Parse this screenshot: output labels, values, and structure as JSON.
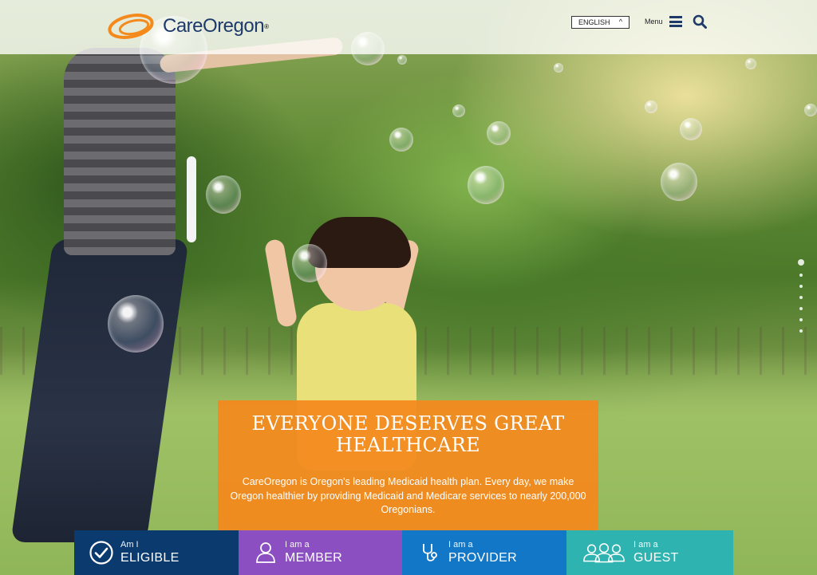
{
  "header": {
    "brand": "CareOregon",
    "language": "ENGLISH",
    "menu_label": "Menu"
  },
  "hero": {
    "headline": "EVERYONE DESERVES GREAT HEALTHCARE",
    "body": "CareOregon is Oregon's leading Medicaid health plan. Every day, we make Oregon healthier by providing Medicaid and Medicare services to nearly 200,000 Oregonians."
  },
  "tiles": [
    {
      "small": "Am I",
      "big": "ELIGIBLE",
      "icon": "check-circle-icon",
      "color": "#0b3a6e"
    },
    {
      "small": "I am a",
      "big": "MEMBER",
      "icon": "person-icon",
      "color": "#8c4fc1"
    },
    {
      "small": "I am a",
      "big": "PROVIDER",
      "icon": "stethoscope-icon",
      "color": "#1277c7"
    },
    {
      "small": "I am a",
      "big": "GUEST",
      "icon": "group-icon",
      "color": "#2fb3b0"
    }
  ],
  "colors": {
    "brand_navy": "#1e3a6b",
    "brand_orange": "#f4891c",
    "callout": "#f4891c"
  },
  "carousel": {
    "slides": 7,
    "active": 1
  }
}
